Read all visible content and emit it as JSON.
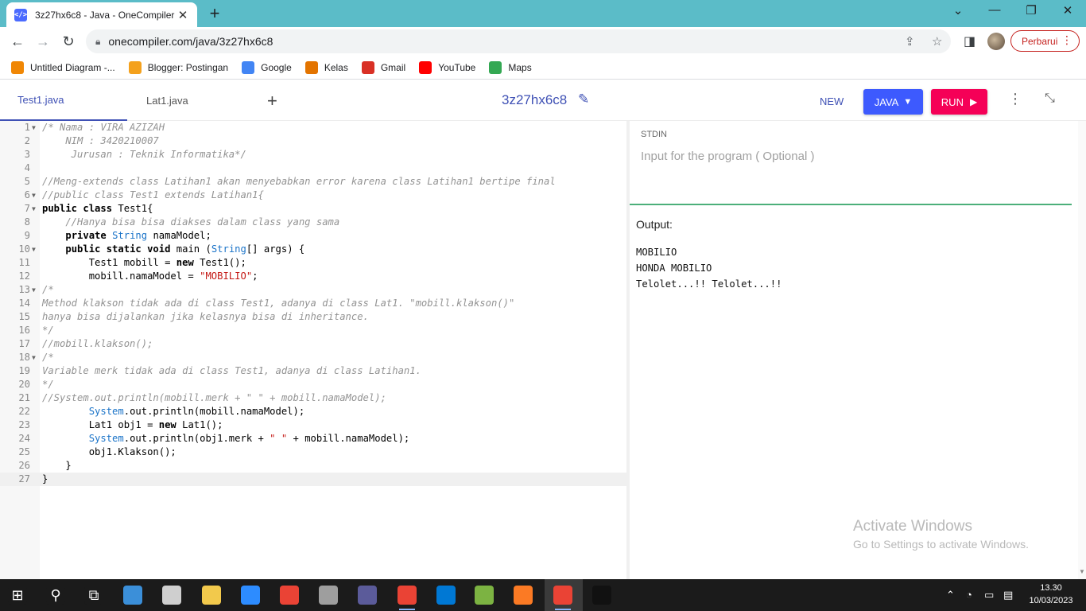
{
  "browser": {
    "tab_title": "3z27hx6c8 - Java - OneCompiler",
    "tab_favicon": "</>",
    "url": "onecompiler.com/java/3z27hx6c8",
    "update_label": "Perbarui"
  },
  "bookmarks": [
    {
      "label": "Untitled Diagram -...",
      "icon": "drawio-icon",
      "color": "#f08705"
    },
    {
      "label": "Blogger: Postingan",
      "icon": "blogger-icon",
      "color": "#f4a11d"
    },
    {
      "label": "Google",
      "icon": "google-icon",
      "color": "#4285f4"
    },
    {
      "label": "Kelas",
      "icon": "classroom-icon",
      "color": "#e37400"
    },
    {
      "label": "Gmail",
      "icon": "gmail-icon",
      "color": "#d93025"
    },
    {
      "label": "YouTube",
      "icon": "youtube-icon",
      "color": "#ff0000"
    },
    {
      "label": "Maps",
      "icon": "maps-icon",
      "color": "#34a853"
    }
  ],
  "compiler": {
    "file_tabs": [
      "Test1.java",
      "Lat1.java"
    ],
    "code_id": "3z27hx6c8",
    "new_label": "NEW",
    "language_label": "JAVA",
    "run_label": "RUN",
    "stdin_label": "STDIN",
    "stdin_placeholder": "Input for the program ( Optional )",
    "output_label": "Output:",
    "output_text": "MOBILIO\nHONDA MOBILIO\nTelolet...!! Telolet...!!"
  },
  "code_lines": [
    {
      "n": "1",
      "fold": true,
      "segs": [
        [
          "c",
          "/* Nama : VIRA AZIZAH"
        ]
      ]
    },
    {
      "n": "2",
      "segs": [
        [
          "c",
          "    NIM : 3420210007"
        ]
      ]
    },
    {
      "n": "3",
      "segs": [
        [
          "c",
          "     Jurusan : Teknik Informatika*/"
        ]
      ]
    },
    {
      "n": "4",
      "segs": []
    },
    {
      "n": "5",
      "segs": [
        [
          "c",
          "//Meng-extends class Latihan1 akan menyebabkan error karena class Latihan1 bertipe final"
        ]
      ]
    },
    {
      "n": "6",
      "fold": true,
      "segs": [
        [
          "c",
          "//public class Test1 extends Latihan1{"
        ]
      ]
    },
    {
      "n": "7",
      "fold": true,
      "segs": [
        [
          "k",
          "public class "
        ],
        [
          "p",
          "Test1{"
        ]
      ]
    },
    {
      "n": "8",
      "segs": [
        [
          "c",
          "    //Hanya bisa bisa diakses dalam class yang sama"
        ]
      ]
    },
    {
      "n": "9",
      "segs": [
        [
          "p",
          "    "
        ],
        [
          "k",
          "private "
        ],
        [
          "t",
          "String "
        ],
        [
          "p",
          "namaModel;"
        ]
      ]
    },
    {
      "n": "10",
      "fold": true,
      "segs": [
        [
          "p",
          "    "
        ],
        [
          "k",
          "public static void "
        ],
        [
          "p",
          "main ("
        ],
        [
          "t",
          "String"
        ],
        [
          "p",
          "[] args) {"
        ]
      ]
    },
    {
      "n": "11",
      "segs": [
        [
          "p",
          "        Test1 mobill = "
        ],
        [
          "k",
          "new "
        ],
        [
          "p",
          "Test1();"
        ]
      ]
    },
    {
      "n": "12",
      "segs": [
        [
          "p",
          "        mobill.namaModel = "
        ],
        [
          "s",
          "\"MOBILIO\""
        ],
        [
          "p",
          ";"
        ]
      ]
    },
    {
      "n": "13",
      "fold": true,
      "segs": [
        [
          "c",
          "/*"
        ]
      ]
    },
    {
      "n": "14",
      "segs": [
        [
          "c",
          "Method klakson tidak ada di class Test1, adanya di class Lat1. \"mobill.klakson()\""
        ]
      ]
    },
    {
      "n": "15",
      "segs": [
        [
          "c",
          "hanya bisa dijalankan jika kelasnya bisa di inheritance."
        ]
      ]
    },
    {
      "n": "16",
      "segs": [
        [
          "c",
          "*/"
        ]
      ]
    },
    {
      "n": "17",
      "segs": [
        [
          "c",
          "//mobill.klakson();"
        ]
      ]
    },
    {
      "n": "18",
      "fold": true,
      "segs": [
        [
          "c",
          "/*"
        ]
      ]
    },
    {
      "n": "19",
      "segs": [
        [
          "c",
          "Variable merk tidak ada di class Test1, adanya di class Latihan1."
        ]
      ]
    },
    {
      "n": "20",
      "segs": [
        [
          "c",
          "*/"
        ]
      ]
    },
    {
      "n": "21",
      "segs": [
        [
          "c",
          "//System.out.println(mobill.merk + \" \" + mobill.namaModel);"
        ]
      ]
    },
    {
      "n": "22",
      "segs": [
        [
          "p",
          "        "
        ],
        [
          "t",
          "System"
        ],
        [
          "p",
          ".out.println(mobill.namaModel);"
        ]
      ]
    },
    {
      "n": "23",
      "segs": [
        [
          "p",
          "        Lat1 obj1 = "
        ],
        [
          "k",
          "new "
        ],
        [
          "p",
          "Lat1();"
        ]
      ]
    },
    {
      "n": "24",
      "segs": [
        [
          "p",
          "        "
        ],
        [
          "t",
          "System"
        ],
        [
          "p",
          ".out.println(obj1.merk + "
        ],
        [
          "s",
          "\" \""
        ],
        [
          "p",
          " + mobill.namaModel);"
        ]
      ]
    },
    {
      "n": "25",
      "segs": [
        [
          "p",
          "        obj1.Klakson();"
        ]
      ]
    },
    {
      "n": "26",
      "segs": [
        [
          "p",
          "    }"
        ]
      ]
    },
    {
      "n": "27",
      "active": true,
      "segs": [
        [
          "p",
          "}"
        ]
      ]
    }
  ],
  "watermark": {
    "line1": "Activate Windows",
    "line2": "Go to Settings to activate Windows."
  },
  "taskbar": {
    "time": "13.30",
    "date": "10/03/2023",
    "apps": [
      {
        "name": "taskbar-start-icon",
        "color": "#1b1b1b"
      },
      {
        "name": "taskbar-search-icon",
        "color": "#1b1b1b"
      },
      {
        "name": "taskbar-taskview-icon",
        "color": "#1b1b1b"
      },
      {
        "name": "taskbar-media-icon",
        "color": "#3b8fd9"
      },
      {
        "name": "taskbar-paint-icon",
        "color": "#cfcfcf"
      },
      {
        "name": "taskbar-explorer-icon",
        "color": "#f2c94c"
      },
      {
        "name": "taskbar-zoom-icon",
        "color": "#2d8cff"
      },
      {
        "name": "taskbar-chrome-icon",
        "color": "#ea4335"
      },
      {
        "name": "taskbar-vm-icon",
        "color": "#9e9e9e"
      },
      {
        "name": "taskbar-calculator-icon",
        "color": "#5b5b9a"
      },
      {
        "name": "taskbar-chrome-profile-icon",
        "color": "#ea4335"
      },
      {
        "name": "taskbar-vscode-icon",
        "color": "#0078d4"
      },
      {
        "name": "taskbar-notepadpp-icon",
        "color": "#7cb342"
      },
      {
        "name": "taskbar-xampp-icon",
        "color": "#fb7a24"
      },
      {
        "name": "taskbar-chrome-active-icon",
        "color": "#ea4335"
      },
      {
        "name": "taskbar-photos-icon",
        "color": "#111111"
      }
    ]
  }
}
